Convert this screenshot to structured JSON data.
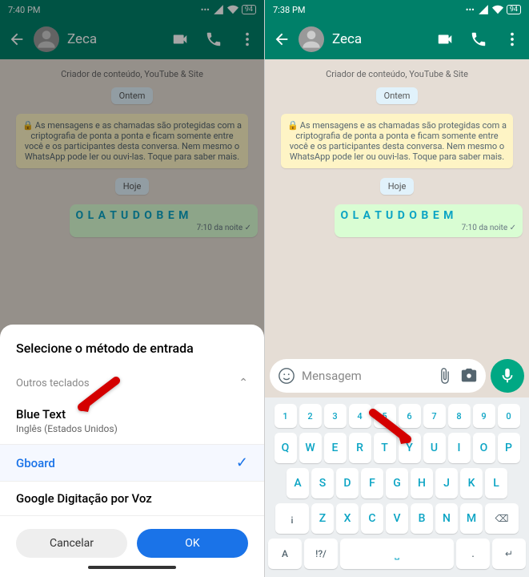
{
  "left": {
    "time": "7:40 PM",
    "battery": "94",
    "contact": "Zeca",
    "subtitle": "Criador de conteúdo, YouTube & Site",
    "date1": "Ontem",
    "encryption": "As mensagens e as chamadas são protegidas com a criptografia de ponta a ponta e ficam somente entre você e os participantes desta conversa. Nem mesmo o WhatsApp pode ler ou ouvi-las. Toque para saber mais.",
    "date2": "Hoje",
    "msg": "O L A  T U D O  B E M",
    "msgTime": "7:10 da noite",
    "sheet": {
      "title": "Selecione o método de entrada",
      "subtitle": "Outros teclados",
      "item1": {
        "title": "Blue Text",
        "sub": "Inglês (Estados Unidos)"
      },
      "item2": {
        "title": "Gboard"
      },
      "item3": {
        "title": "Google Digitação por Voz"
      },
      "cancel": "Cancelar",
      "ok": "OK"
    }
  },
  "right": {
    "time": "7:38 PM",
    "battery": "94",
    "contact": "Zeca",
    "subtitle": "Criador de conteúdo, YouTube & Site",
    "date1": "Ontem",
    "encryption": "As mensagens e as chamadas são protegidas com a criptografia de ponta a ponta e ficam somente entre você e os participantes desta conversa. Nem mesmo o WhatsApp pode ler ou ouvi-las. Toque para saber mais.",
    "date2": "Hoje",
    "msg": "O L A  T U D O  B E M",
    "msgTime": "7:10 da noite",
    "placeholder": "Mensagem",
    "keyboard": {
      "nums": [
        "1",
        "2",
        "3",
        "4",
        "5",
        "6",
        "7",
        "8",
        "9",
        "0"
      ],
      "row1": [
        "Q",
        "W",
        "E",
        "R",
        "T",
        "Y",
        "U",
        "I",
        "O",
        "P"
      ],
      "row2": [
        "A",
        "S",
        "D",
        "F",
        "G",
        "H",
        "J",
        "K",
        "L"
      ],
      "row3": [
        "Z",
        "X",
        "C",
        "V",
        "B",
        "N",
        "M"
      ],
      "shift": "¡",
      "symbols": "!?/",
      "lang": "A"
    }
  }
}
